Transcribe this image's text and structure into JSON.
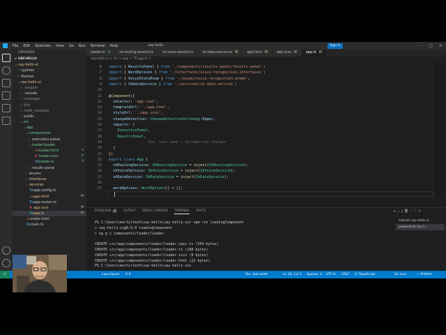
{
  "titlebar": {
    "menu": [
      "File",
      "Edit",
      "Selection",
      "View",
      "Go",
      "Run",
      "Terminal",
      "Help"
    ],
    "window_title": "say-hello",
    "signin_label": "Sign In"
  },
  "sidebar": {
    "header": "EXPLORER",
    "root": "SAY-HELLO",
    "items": [
      {
        "label": "say-hello-ui",
        "depth": 0,
        "chev": "v",
        "color": "#e2c08d"
      },
      {
        "label": "cypress",
        "depth": 1,
        "chev": ">",
        "color": "#cccccc"
      },
      {
        "label": "fileman",
        "depth": 1,
        "chev": ">",
        "color": "#cccccc"
      },
      {
        "label": "say-hello-ui",
        "depth": 1,
        "chev": "v",
        "color": "#e2c08d"
      },
      {
        "label": ".angular",
        "depth": 2,
        "chev": ">",
        "color": "#8c8c8c"
      },
      {
        "label": ".vscode",
        "depth": 2,
        "chev": ">",
        "color": "#cccccc"
      },
      {
        "label": "coverage",
        "depth": 2,
        "chev": ">",
        "color": "#8c8c8c"
      },
      {
        "label": "dist",
        "depth": 2,
        "chev": ">",
        "color": "#8c8c8c"
      },
      {
        "label": "node_modules",
        "depth": 2,
        "chev": ">",
        "color": "#8c8c8c"
      },
      {
        "label": "public",
        "depth": 2,
        "chev": ">",
        "color": "#cccccc"
      },
      {
        "label": "src",
        "depth": 2,
        "chev": "v",
        "color": "#73c991"
      },
      {
        "label": "app",
        "depth": 3,
        "chev": "v",
        "color": "#73c991"
      },
      {
        "label": "components",
        "depth": 4,
        "chev": "v",
        "color": "#73c991"
      },
      {
        "label": "execution-panel",
        "depth": 5,
        "chev": ">",
        "color": "#cccccc"
      },
      {
        "label": "loader\\loader",
        "depth": 5,
        "chev": "v",
        "color": "#73c991"
      },
      {
        "label": "loader.html",
        "depth": 6,
        "chev": "",
        "color": "#73c991",
        "icon": "<>",
        "icon_color": "#e37933",
        "badge": "U"
      },
      {
        "label": "loader.scss",
        "depth": 6,
        "chev": "",
        "color": "#73c991",
        "icon": "#",
        "icon_color": "#f55385",
        "badge": "U"
      },
      {
        "label": "loader.ts",
        "depth": 6,
        "chev": "",
        "color": "#73c991",
        "icon": "TS",
        "icon_color": "#519aba",
        "badge": "U"
      },
      {
        "label": "results-panel",
        "depth": 5,
        "chev": ">",
        "color": "#cccccc"
      },
      {
        "label": "enums",
        "depth": 4,
        "chev": ">",
        "color": "#cccccc"
      },
      {
        "label": "interfaces",
        "depth": 4,
        "chev": ">",
        "color": "#e2c08d"
      },
      {
        "label": "services",
        "depth": 4,
        "chev": ">",
        "color": "#e2c08d"
      },
      {
        "label": "app.config.ts",
        "depth": 4,
        "chev": "",
        "color": "#cccccc",
        "icon": "TS",
        "icon_color": "#519aba"
      },
      {
        "label": "app.html",
        "depth": 4,
        "chev": "",
        "color": "#e2c08d",
        "icon": "<>",
        "icon_color": "#e37933",
        "badge": "M"
      },
      {
        "label": "app.routes.ts",
        "depth": 4,
        "chev": "",
        "color": "#cccccc",
        "icon": "TS",
        "icon_color": "#519aba"
      },
      {
        "label": "app.scss",
        "depth": 4,
        "chev": "",
        "color": "#e2c08d",
        "icon": "#",
        "icon_color": "#f55385",
        "badge": "M"
      },
      {
        "label": "app.ts",
        "depth": 4,
        "chev": "",
        "color": "#e2c08d",
        "icon": "TS",
        "icon_color": "#519aba",
        "badge": "M",
        "selected": true
      },
      {
        "label": "index.html",
        "depth": 3,
        "chev": "",
        "color": "#cccccc",
        "icon": "<>",
        "icon_color": "#e37933"
      },
      {
        "label": "main.ts",
        "depth": 3,
        "chev": "",
        "color": "#cccccc",
        "icon": "TS",
        "icon_color": "#519aba"
      }
    ]
  },
  "tabs": [
    {
      "label": "loader.ts",
      "modified": "U",
      "active": false
    },
    {
      "label": "sh-routing.service.ts",
      "modified": "",
      "active": false
    },
    {
      "label": "sh-voice.service.ts",
      "modified": "",
      "active": false
    },
    {
      "label": "sh-data.service.ts",
      "modified": "M",
      "active": false
    },
    {
      "label": "app.html",
      "modified": "M",
      "active": false
    },
    {
      "label": "app.scss",
      "modified": "M",
      "active": false
    },
    {
      "label": "app.ts",
      "modified": "M",
      "active": true
    }
  ],
  "breadcrumb": "say-hello-ui > src > app > TS app.ts > ...",
  "editor": {
    "lines": [
      {
        "n": "6",
        "segs": [
          [
            "k",
            "import"
          ],
          [
            "p",
            " { "
          ],
          [
            "v",
            "ResultsPanel"
          ],
          [
            "p",
            " } "
          ],
          [
            "k",
            "from"
          ],
          [
            "p",
            " "
          ],
          [
            "s",
            "'./components/results-panel/results-panel'"
          ],
          [
            "p",
            ";"
          ]
        ]
      },
      {
        "n": "7",
        "segs": [
          [
            "k",
            "import"
          ],
          [
            "p",
            " { "
          ],
          [
            "v",
            "WordOptions"
          ],
          [
            "p",
            " } "
          ],
          [
            "k",
            "from"
          ],
          [
            "p",
            " "
          ],
          [
            "s",
            "'./interfaces/voice-recognition.interfaces'"
          ],
          [
            "p",
            ";"
          ]
        ]
      },
      {
        "n": "8",
        "segs": [
          [
            "k",
            "import"
          ],
          [
            "p",
            " { "
          ],
          [
            "v",
            "VoiceStateEnum"
          ],
          [
            "p",
            " } "
          ],
          [
            "k",
            "from"
          ],
          [
            "p",
            " "
          ],
          [
            "s",
            "'./enums/voice-recognition.enums'"
          ],
          [
            "p",
            ";"
          ]
        ]
      },
      {
        "n": "9",
        "segs": [
          [
            "k",
            "import"
          ],
          [
            "p",
            " { "
          ],
          [
            "v",
            "ShDataService"
          ],
          [
            "p",
            " } "
          ],
          [
            "k",
            "from"
          ],
          [
            "p",
            " "
          ],
          [
            "s",
            "'./services/sh-data.service'"
          ],
          [
            "p",
            ";"
          ]
        ]
      },
      {
        "n": "10",
        "segs": []
      },
      {
        "n": "11",
        "segs": [
          [
            "dec",
            "@Component"
          ],
          [
            "p",
            "({"
          ]
        ]
      },
      {
        "n": "12",
        "segs": [
          [
            "p",
            "  "
          ],
          [
            "v",
            "selector"
          ],
          [
            "p",
            ": "
          ],
          [
            "s",
            "'app-root'"
          ],
          [
            "p",
            ","
          ]
        ]
      },
      {
        "n": "13",
        "segs": [
          [
            "p",
            "  "
          ],
          [
            "v",
            "templateUrl"
          ],
          [
            "p",
            ": "
          ],
          [
            "s",
            "'./app.html'"
          ],
          [
            "p",
            ","
          ]
        ]
      },
      {
        "n": "14",
        "segs": [
          [
            "p",
            "  "
          ],
          [
            "v",
            "styleUrl"
          ],
          [
            "p",
            ": "
          ],
          [
            "s",
            "'./app.scss'"
          ],
          [
            "p",
            ","
          ]
        ]
      },
      {
        "n": "15",
        "segs": [
          [
            "p",
            "  "
          ],
          [
            "v",
            "changeDetection"
          ],
          [
            "p",
            ": "
          ],
          [
            "t",
            "ChangeDetectionStrategy"
          ],
          [
            "p",
            "."
          ],
          [
            "v",
            "Eager"
          ],
          [
            "p",
            ","
          ]
        ]
      },
      {
        "n": "16",
        "segs": [
          [
            "p",
            "  "
          ],
          [
            "v",
            "imports"
          ],
          [
            "p",
            ": ["
          ]
        ]
      },
      {
        "n": "17",
        "segs": [
          [
            "p",
            "    "
          ],
          [
            "t",
            "ExecutionPanel"
          ],
          [
            "p",
            ","
          ]
        ]
      },
      {
        "n": "18",
        "segs": [
          [
            "p",
            "    "
          ],
          [
            "t",
            "ResultsPanel"
          ],
          [
            "p",
            ","
          ]
        ]
      },
      {
        "n": "19",
        "segs": [
          [
            "p",
            "  "
          ],
          [
            "ghost",
            "                You, last week • Uncommitted changes"
          ]
        ]
      },
      {
        "n": "20",
        "segs": [
          [
            "p",
            "  ]"
          ]
        ]
      },
      {
        "n": "21",
        "segs": [
          [
            "p",
            "})"
          ]
        ]
      },
      {
        "n": "22",
        "segs": [
          [
            "k",
            "export"
          ],
          [
            "p",
            " "
          ],
          [
            "k",
            "class"
          ],
          [
            "p",
            " "
          ],
          [
            "t",
            "App"
          ],
          [
            "p",
            " {"
          ]
        ]
      },
      {
        "n": "23",
        "segs": [
          [
            "p",
            "  "
          ],
          [
            "v",
            "shRoutingService"
          ],
          [
            "p",
            ": "
          ],
          [
            "t",
            "ShRoutingService"
          ],
          [
            "p",
            " = "
          ],
          [
            "f",
            "inject"
          ],
          [
            "p",
            "("
          ],
          [
            "t",
            "ShRoutingService"
          ],
          [
            "p",
            ");"
          ]
        ]
      },
      {
        "n": "24",
        "segs": [
          [
            "p",
            "  "
          ],
          [
            "v",
            "shVoiceService"
          ],
          [
            "p",
            ": "
          ],
          [
            "t",
            "ShVoiceService"
          ],
          [
            "p",
            " = "
          ],
          [
            "f",
            "inject"
          ],
          [
            "p",
            "("
          ],
          [
            "t",
            "ShVoiceService"
          ],
          [
            "p",
            ");"
          ]
        ]
      },
      {
        "n": "25",
        "segs": [
          [
            "p",
            "  "
          ],
          [
            "v",
            "shDataService"
          ],
          [
            "p",
            ": "
          ],
          [
            "t",
            "ShDataService"
          ],
          [
            "p",
            " = "
          ],
          [
            "f",
            "inject"
          ],
          [
            "p",
            "("
          ],
          [
            "t",
            "ShDataService"
          ],
          [
            "p",
            ");"
          ]
        ]
      },
      {
        "n": "26",
        "segs": []
      },
      {
        "n": "27",
        "segs": [
          [
            "p",
            "  "
          ],
          [
            "v",
            "wordOptions"
          ],
          [
            "p",
            ": "
          ],
          [
            "t",
            "WordOptions"
          ],
          [
            "p",
            "[] = [];"
          ]
        ]
      }
    ]
  },
  "panel": {
    "tabs": [
      "PROBLEMS",
      "OUTPUT",
      "DEBUG CONSOLE",
      "TERMINAL",
      "PORTS"
    ],
    "problems_count": "3",
    "active_tab": "TERMINAL",
    "terminal_lines": [
      "PS C:\\Users\\marty\\tech\\say-hello\\say-hello-ui> npm run loadingComponent",
      "> say-hello-ui@0.0.0 loadingComponent",
      "> ng g c components/loader/loader",
      "",
      "CREATE src/app/components/loader/loader.spec.ts (554 bytes)",
      "CREATE src/app/components/loader/loader.ts (198 bytes)",
      "CREATE src/app/components/loader/loader.scss (0 bytes)",
      "CREATE src/app/components/loader/loader.html (22 bytes)",
      "PS C:\\Users\\marty\\tech\\say-hello\\say-hello-ui> "
    ],
    "terminal_list": [
      {
        "label": "esbuild  say-hello-ui",
        "active": false
      },
      {
        "label": "powershell  say-h...",
        "active": true
      }
    ]
  },
  "statusbar": {
    "branch": "main*",
    "sync": "⟳",
    "errors": "⊗ 0 △ 0",
    "launchpad": "Launchpad",
    "ports": "⚲ 0",
    "blame": "You, last week",
    "position": "Ln 19, Col 5",
    "spaces": "Spaces: 2",
    "encoding": "UTF-8",
    "eol": "CRLF",
    "language": "{} TypeScript",
    "golive": "Go Live",
    "prettier": "✓ Prettier"
  },
  "colors": {
    "accent": "#007acc",
    "editor_bg": "#1e1e1e",
    "sidebar_bg": "#252526"
  }
}
